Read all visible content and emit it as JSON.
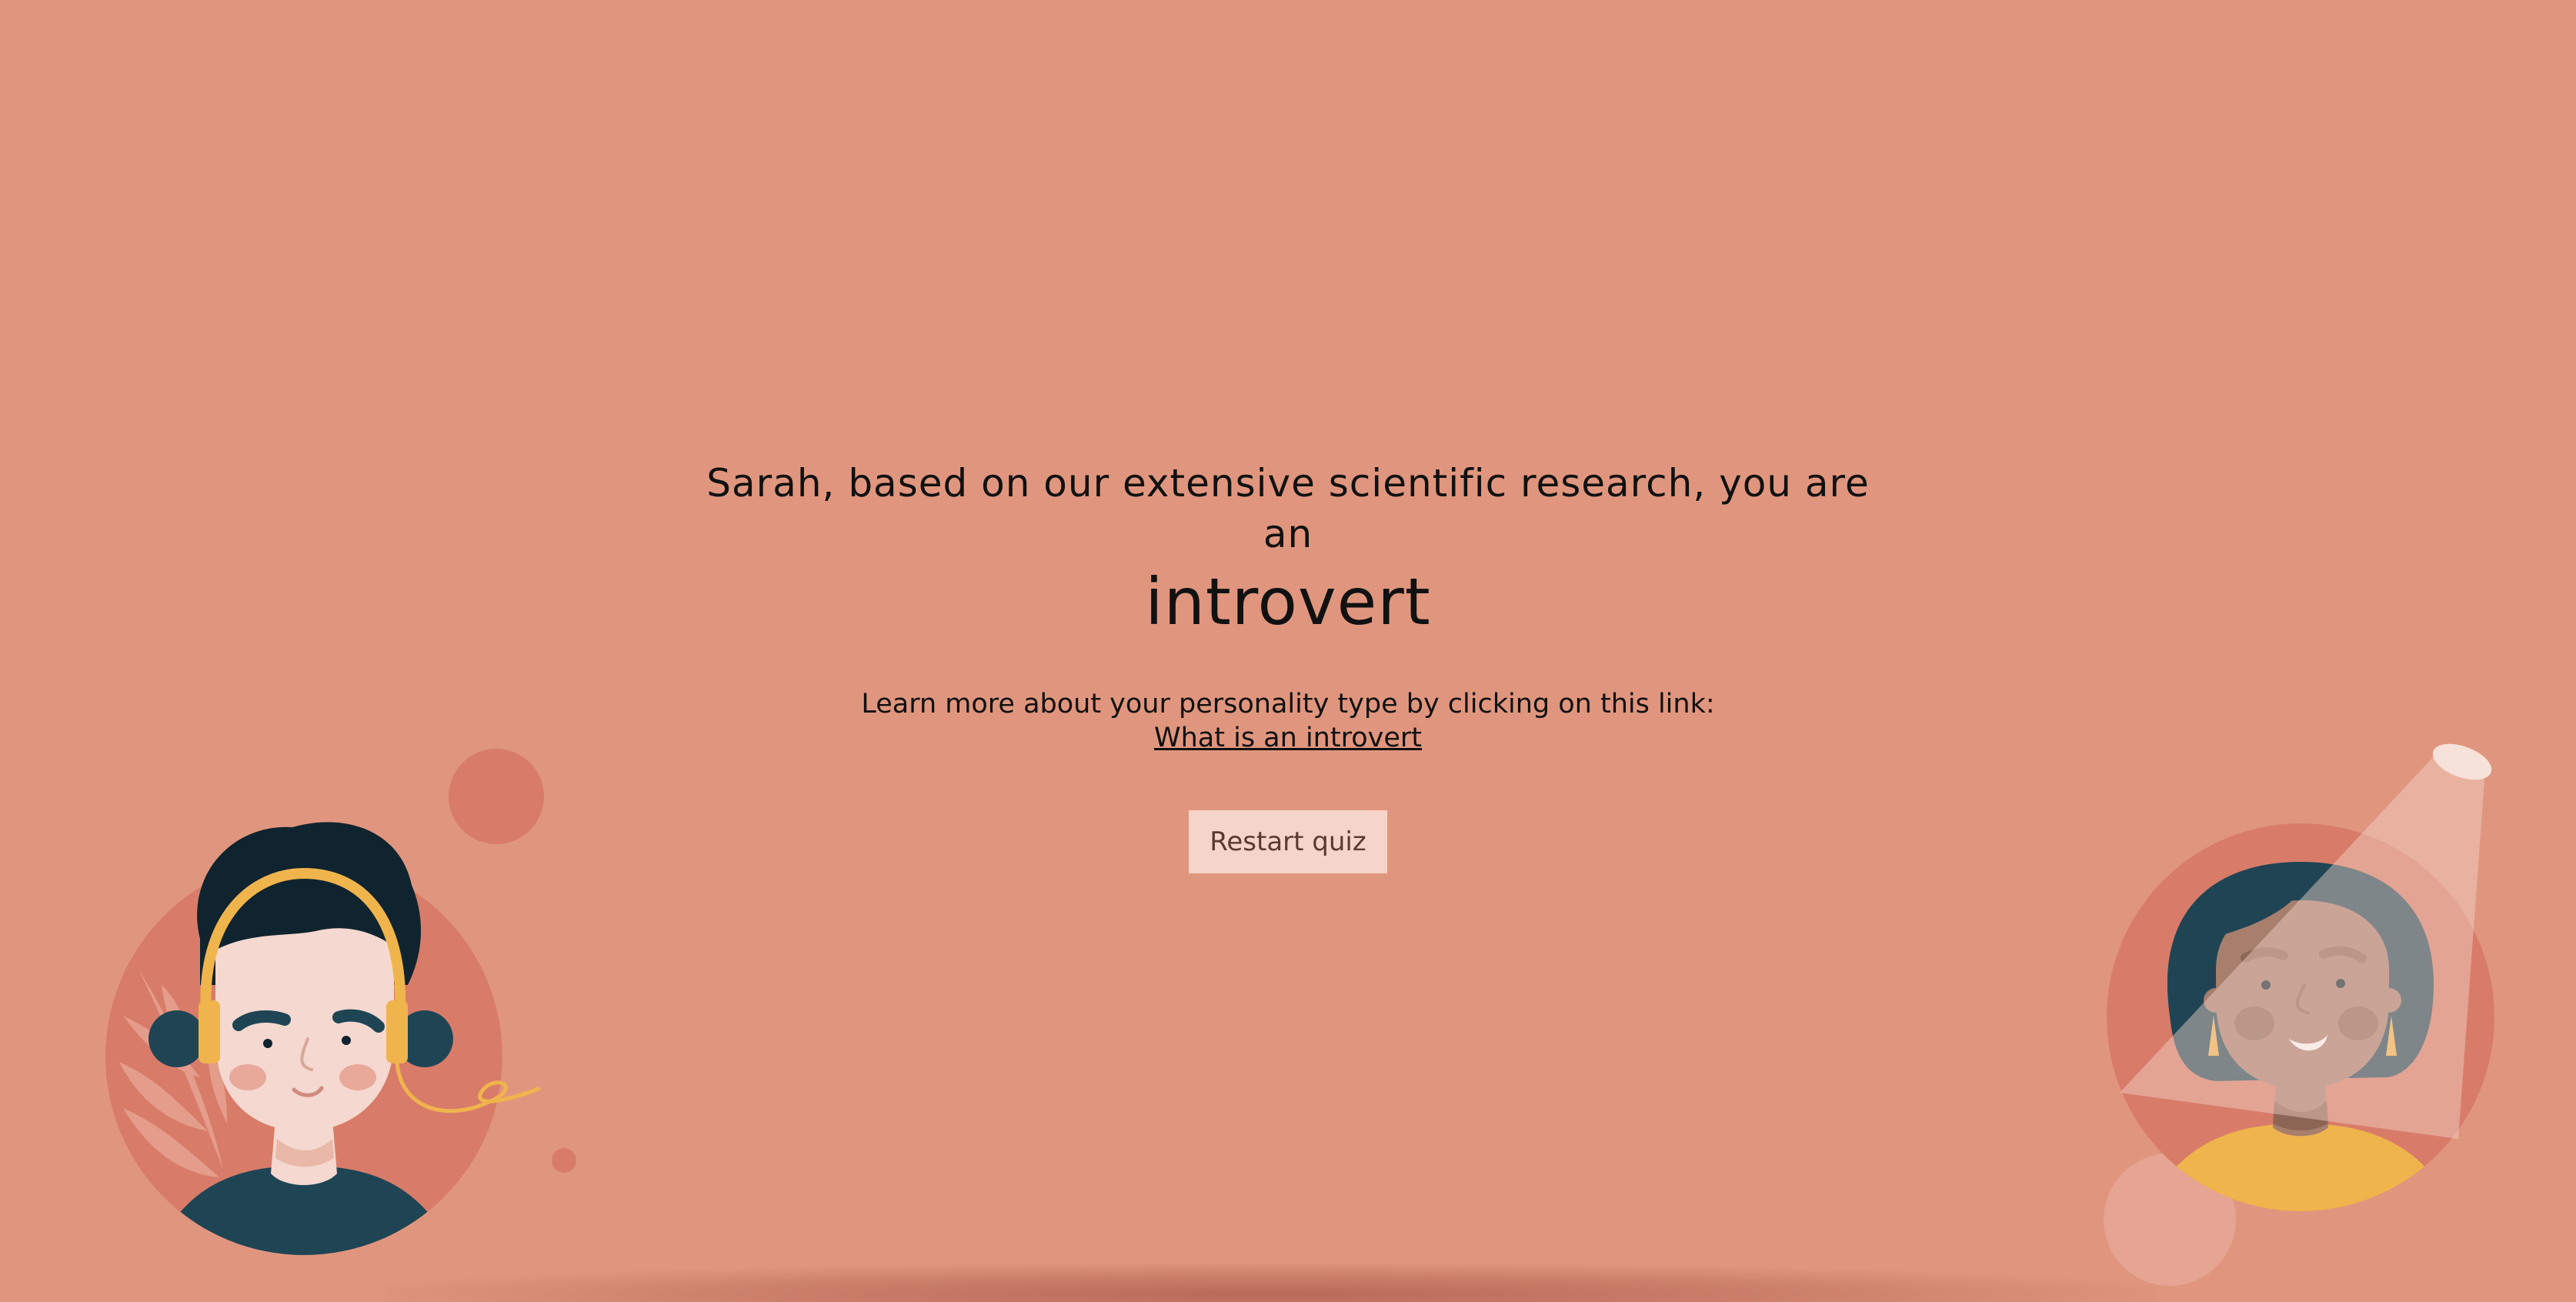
{
  "result": {
    "lead_text": "Sarah, based on our extensive scientific research, you are an",
    "personality_type": "introvert",
    "learn_more_text": "Learn more about your personality type by clicking on this link:",
    "learn_more_link": "What is an introvert",
    "restart_label": "Restart quiz"
  },
  "colors": {
    "background": "#e0967e",
    "circle": "#d87c69",
    "button_bg": "#f5d5c9",
    "hair_dark": "#1f4555",
    "headphones": "#f0b44c",
    "skin_light": "#f5d8cf",
    "skin_dark": "#a87e6d"
  },
  "illustrations": {
    "left": "boy-with-headphones-illustration",
    "right": "woman-with-earrings-illustration"
  }
}
